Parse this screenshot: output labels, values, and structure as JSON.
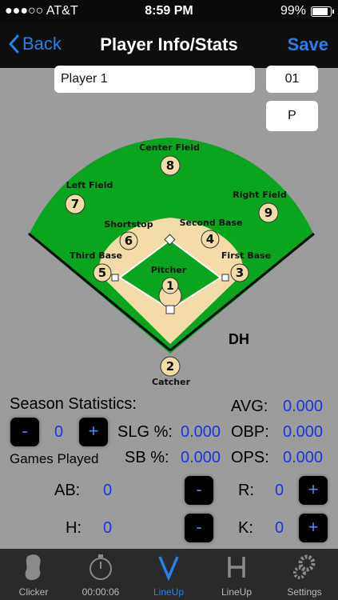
{
  "status_bar": {
    "carrier": "●●●○○ AT&T",
    "time": "8:59 PM",
    "battery": "99%"
  },
  "nav": {
    "back_label": "Back",
    "title": "Player Info/Stats",
    "save_label": "Save"
  },
  "player": {
    "name": "Player 1",
    "number": "01",
    "position": "P"
  },
  "diagram": {
    "positions": [
      {
        "num": "1",
        "label": "Pitcher"
      },
      {
        "num": "2",
        "label": "Catcher"
      },
      {
        "num": "3",
        "label": "First Base"
      },
      {
        "num": "4",
        "label": "Second Base"
      },
      {
        "num": "5",
        "label": "Third Base"
      },
      {
        "num": "6",
        "label": "Shortstop"
      },
      {
        "num": "7",
        "label": "Left Field"
      },
      {
        "num": "8",
        "label": "Center Field"
      },
      {
        "num": "9",
        "label": "Right Field"
      }
    ],
    "dh_label": "DH"
  },
  "stats": {
    "header": "Season Statistics:",
    "minus": "-",
    "plus": "+",
    "games_played_value": "0",
    "games_played_label": "Games Played",
    "avg_label": "AVG:",
    "avg_value": "0.000",
    "slg_label": "SLG %:",
    "slg_value": "0.000",
    "obp_label": "OBP:",
    "obp_value": "0.000",
    "sb_label": "SB %:",
    "sb_value": "0.000",
    "ops_label": "OPS:",
    "ops_value": "0.000",
    "ab_label": "AB:",
    "ab_value": "0",
    "r_label": "R:",
    "r_value": "0",
    "h_label": "H:",
    "h_value": "0",
    "k_label": "K:",
    "k_value": "0"
  },
  "tabs": [
    {
      "label": "Clicker",
      "icon": "mitt-icon"
    },
    {
      "label": "00:00:06",
      "icon": "stopwatch-icon"
    },
    {
      "label": "LineUp",
      "icon": "v-icon"
    },
    {
      "label": "LineUp",
      "icon": "h-icon"
    },
    {
      "label": "Settings",
      "icon": "gears-icon"
    }
  ]
}
